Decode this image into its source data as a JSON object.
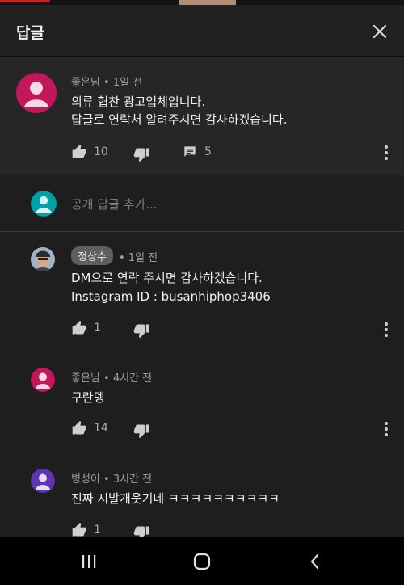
{
  "header": {
    "title": "답글"
  },
  "parent_comment": {
    "author": "좋은님",
    "time": "• 1일 전",
    "lines": [
      "의류 협찬 광고업체입니다.",
      "답글로 연락처 알려주시면 감사하겠습니다."
    ],
    "likes": "10",
    "replies": "5",
    "avatar_color": "#c2185b"
  },
  "add_reply": {
    "placeholder": "공개 답글 추가...",
    "avatar_color": "#00a0a8"
  },
  "replies": [
    {
      "author": "정상수",
      "time": "• 1일 전",
      "lines": [
        "DM으로 연락 주시면 감사하겠습니다.",
        "Instagram ID : busanhiphop3406"
      ],
      "likes": "1"
    },
    {
      "author": "좋은님",
      "time": "• 4시간 전",
      "lines": [
        "구란뎅"
      ],
      "likes": "14",
      "avatar_color": "#c2185b"
    },
    {
      "author": "병성이",
      "time": "• 3시간 전",
      "lines": [
        "진짜 시발개웃기네 ㅋㅋㅋㅋㅋㅋㅋㅋㅋㅋ"
      ],
      "likes": "1",
      "avatar_color": "#5e35b1"
    }
  ],
  "colors": {
    "background": "#1e1e1e",
    "parent_background": "#262626",
    "chip": "#5f5f5f"
  }
}
